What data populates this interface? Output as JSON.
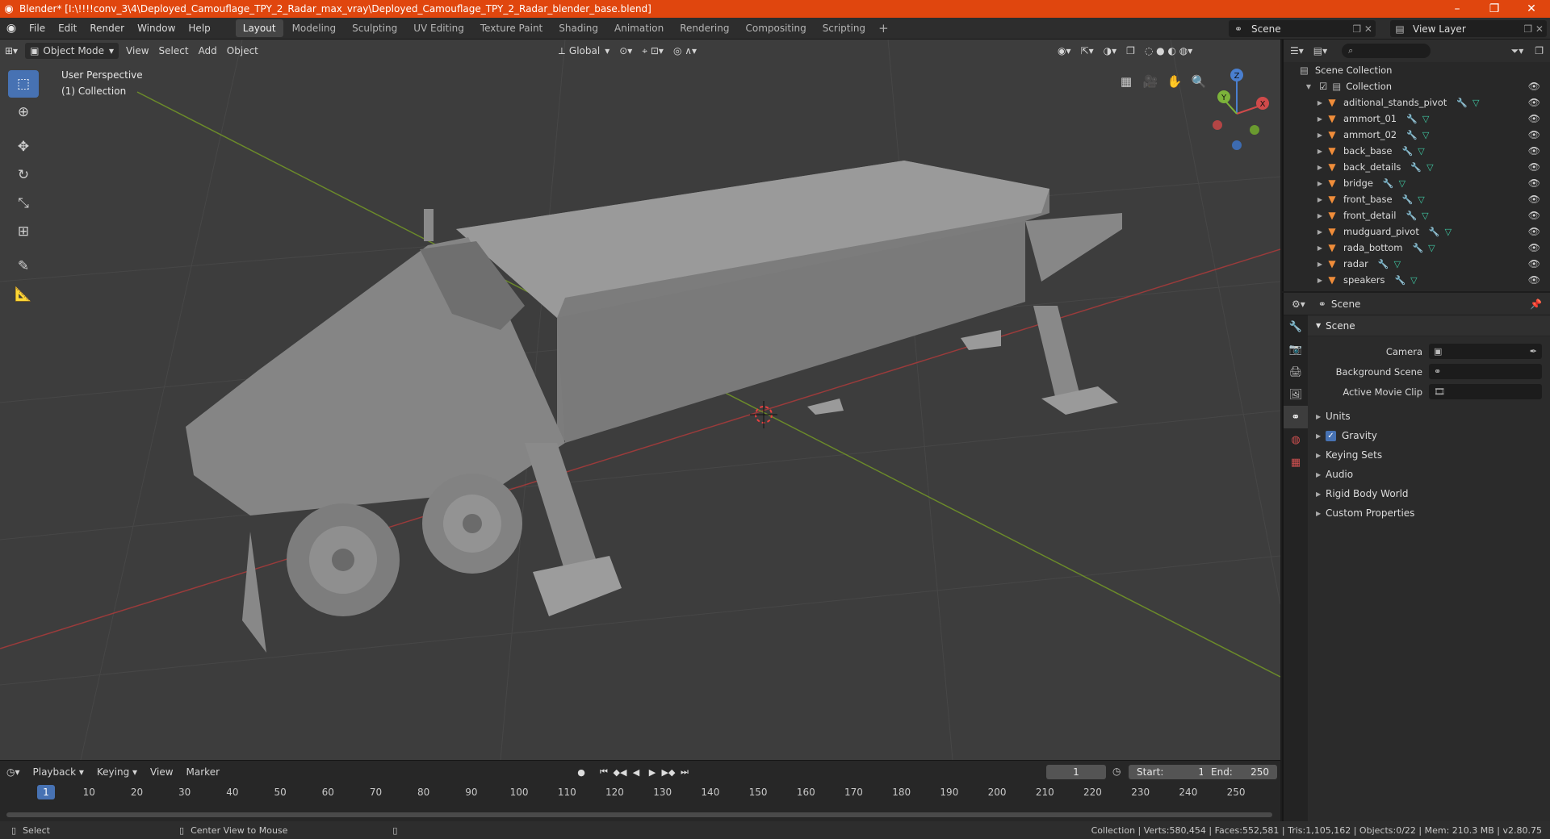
{
  "titlebar": {
    "title": "Blender* [I:\\!!!!conv_3\\4\\Deployed_Camouflage_TPY_2_Radar_max_vray\\Deployed_Camouflage_TPY_2_Radar_blender_base.blend]",
    "minimize": "–",
    "maximize": "❐",
    "close": "✕"
  },
  "menu": [
    "File",
    "Edit",
    "Render",
    "Window",
    "Help"
  ],
  "workspaces": [
    "Layout",
    "Modeling",
    "Sculpting",
    "UV Editing",
    "Texture Paint",
    "Shading",
    "Animation",
    "Rendering",
    "Compositing",
    "Scripting"
  ],
  "active_workspace": "Layout",
  "scene_selector": "Scene",
  "view_layer_selector": "View Layer",
  "viewport": {
    "mode": "Object Mode",
    "menus": [
      "View",
      "Select",
      "Add",
      "Object"
    ],
    "transform_orientation": "Global",
    "info_line1": "User Perspective",
    "info_line2": "(1) Collection",
    "gizmo": {
      "x": "X",
      "y": "Y",
      "z": "Z"
    }
  },
  "timeline": {
    "menus": [
      "Playback",
      "Keying",
      "View",
      "Marker"
    ],
    "current_frame": "1",
    "start_label": "Start:",
    "start": "1",
    "end_label": "End:",
    "end": "250",
    "ruler": [
      "1",
      "10",
      "20",
      "30",
      "40",
      "50",
      "60",
      "70",
      "80",
      "90",
      "100",
      "110",
      "120",
      "130",
      "140",
      "150",
      "160",
      "170",
      "180",
      "190",
      "200",
      "210",
      "220",
      "230",
      "240",
      "250"
    ]
  },
  "status": {
    "select": "Select",
    "center_view": "Center View to Mouse",
    "stats": "Collection | Verts:580,454 | Faces:552,581 | Tris:1,105,162 | Objects:0/22 | Mem: 210.3 MB | v2.80.75"
  },
  "outliner": {
    "scene_collection": "Scene Collection",
    "collection": "Collection",
    "items": [
      "aditional_stands_pivot",
      "ammort_01",
      "ammort_02",
      "back_base",
      "back_details",
      "bridge",
      "front_base",
      "front_detail",
      "mudguard_pivot",
      "rada_bottom",
      "radar",
      "speakers"
    ]
  },
  "properties": {
    "header": "Scene",
    "panel": "Scene",
    "camera_label": "Camera",
    "background_label": "Background Scene",
    "movie_clip_label": "Active Movie Clip",
    "subpanels": [
      "Units",
      "Gravity",
      "Keying Sets",
      "Audio",
      "Rigid Body World",
      "Custom Properties"
    ]
  },
  "colors": {
    "accent": "#4772b3",
    "titlebar": "#e0460e",
    "viewport_bg": "#3d3d3d",
    "object_icon": "#f08d3a"
  }
}
